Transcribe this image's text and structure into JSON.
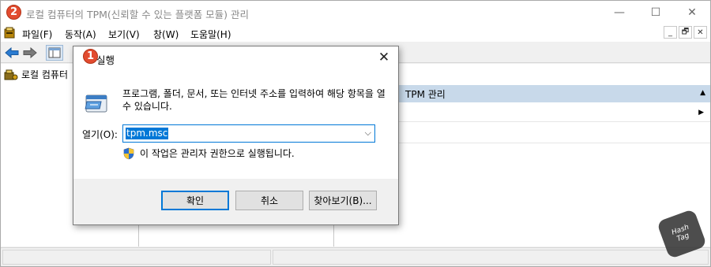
{
  "mmc": {
    "title": "로컬 컴퓨터의 TPM(신뢰할 수 있는 플랫폼 모듈) 관리",
    "window_controls": {
      "minimize": "—",
      "maximize": "☐",
      "close": "✕"
    },
    "menu": [
      "파일(F)",
      "동작(A)",
      "보기(V)",
      "창(W)",
      "도움말(H)"
    ],
    "mdi_controls": [
      "_",
      "🗗",
      "✕"
    ],
    "tree_root": "로컬 컴퓨터",
    "action_header": "TPM 관리"
  },
  "run_dialog": {
    "title": "실행",
    "description": "프로그램, 폴더, 문서, 또는 인터넷 주소를 입력하여 해당 항목을 열 수 있습니다.",
    "open_label": "열기(O):",
    "open_value": "tpm.msc",
    "admin_note": "이 작업은 관리자 권한으로 실행됩니다.",
    "buttons": {
      "ok": "확인",
      "cancel": "취소",
      "browse": "찾아보기(B)..."
    }
  },
  "markers": {
    "one": "1",
    "two": "2"
  },
  "watermark": {
    "line1": "Hash",
    "line2": "Tag"
  },
  "colors": {
    "accent": "#0078d7",
    "marker": "#e24b2f",
    "action_header_bg": "#c8d9ea"
  }
}
